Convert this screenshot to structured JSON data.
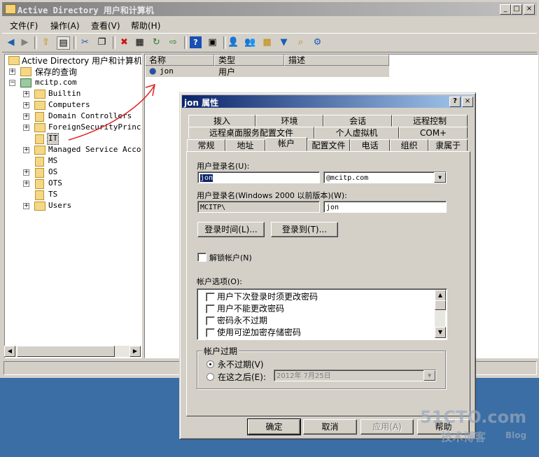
{
  "main_window": {
    "title": "Active Directory 用户和计算机",
    "menu": [
      "文件(F)",
      "操作(A)",
      "查看(V)",
      "帮助(H)"
    ],
    "caption_buttons": [
      "_",
      "□",
      "×"
    ]
  },
  "toolbar": {
    "icons": [
      "back-icon",
      "forward-icon",
      "up-folder-icon",
      "console-tree-icon",
      "cut-icon",
      "copy-icon",
      "delete-icon",
      "properties-icon",
      "refresh-icon",
      "export-icon",
      "help-icon",
      "view-icon",
      "add-user-icon",
      "add-group-icon",
      "add-ou-icon",
      "filter-icon",
      "find-icon",
      "delegate-icon"
    ]
  },
  "tree": {
    "root": "Active Directory 用户和计算机",
    "saved_queries": "保存的查询",
    "domain": "mcitp.com",
    "children": [
      "Builtin",
      "Computers",
      "Domain Controllers",
      "ForeignSecurityPrincip",
      "IT",
      "Managed Service Accour",
      "MS",
      "OS",
      "OTS",
      "TS",
      "Users"
    ]
  },
  "list": {
    "columns": [
      "名称",
      "类型",
      "描述"
    ],
    "rows": [
      {
        "name": "jon",
        "type": "用户",
        "desc": ""
      }
    ]
  },
  "dialog": {
    "title": "jon 属性",
    "help": "?",
    "close": "×",
    "tabs_row1": [
      "拨入",
      "环境",
      "会话",
      "远程控制"
    ],
    "tabs_row2": [
      "远程桌面服务配置文件",
      "个人虚拟机",
      "COM+"
    ],
    "tabs_row3": [
      "常规",
      "地址",
      "帐户",
      "配置文件",
      "电话",
      "组织",
      "隶属于"
    ],
    "logon_name_label": "用户登录名(U):",
    "logon_name_value": "jon",
    "upn_suffix": "@mcitp.com",
    "pre2000_label": "用户登录名(Windows 2000 以前版本)(W):",
    "pre2000_domain": "MCITP\\",
    "pre2000_user": "jon",
    "logon_hours_btn": "登录时间(L)...",
    "logon_to_btn": "登录到(T)...",
    "unlock_label": "解锁帐户(N)",
    "options_label": "帐户选项(O):",
    "options": [
      "用户下次登录时须更改密码",
      "用户不能更改密码",
      "密码永不过期",
      "使用可逆加密存储密码"
    ],
    "expire_group": "帐户过期",
    "never_expire": "永不过期(V)",
    "end_of": "在这之后(E):",
    "expire_date": "2012年 7月25日",
    "ok": "确定",
    "cancel": "取消",
    "apply": "应用(A)",
    "help_btn": "帮助"
  },
  "watermark": {
    "line1": "51CTO.com",
    "line2": "技术博客",
    "line3": "Blog"
  },
  "colors": {
    "active_title": "#0a246a",
    "inactive_title": "#808080",
    "face": "#d4d0c8",
    "annotation": "#e02020"
  }
}
